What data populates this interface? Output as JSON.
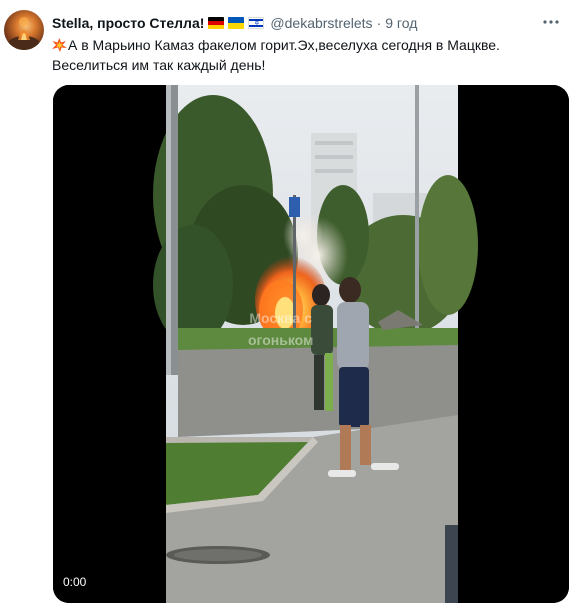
{
  "tweet": {
    "display_name": "Stella, просто Стелла!",
    "handle": "@dekabrstrelets",
    "separator": "·",
    "time": "9 год",
    "flags": [
      "germany-flag",
      "ukraine-flag",
      "israel-flag"
    ],
    "text_line1": "А в Марьино Камаз факелом горит.Эх,веселуха сегодня в Мацкве.",
    "text_line2": "Веселиться им так каждый день!",
    "leading_emoji": "collision-icon"
  },
  "video": {
    "timestamp": "0:00",
    "watermark_line1": "Москва с",
    "watermark_line2": "огоньком"
  },
  "colors": {
    "text_primary": "#0f1419",
    "text_secondary": "#536471",
    "media_background": "#000000"
  }
}
